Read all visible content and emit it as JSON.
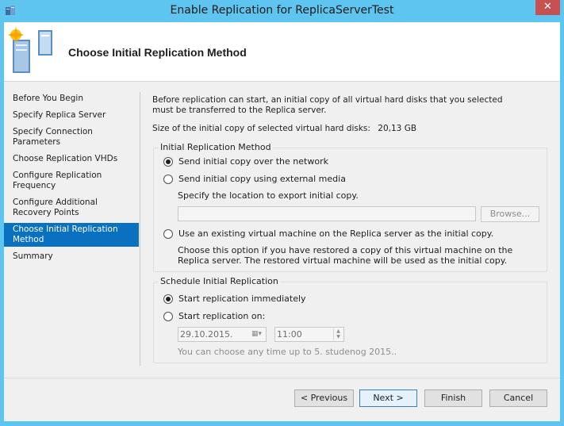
{
  "window": {
    "title": "Enable Replication for ReplicaServerTest",
    "close_glyph": "✕"
  },
  "header": {
    "title": "Choose Initial Replication Method",
    "icon": "server-wizard-icon"
  },
  "nav": {
    "items": [
      {
        "label": "Before You Begin",
        "active": false
      },
      {
        "label": "Specify Replica Server",
        "active": false
      },
      {
        "label": "Specify Connection Parameters",
        "active": false
      },
      {
        "label": "Choose Replication VHDs",
        "active": false
      },
      {
        "label": "Configure Replication Frequency",
        "active": false
      },
      {
        "label": "Configure Additional Recovery Points",
        "active": false
      },
      {
        "label": "Choose Initial Replication Method",
        "active": true
      },
      {
        "label": "Summary",
        "active": false
      }
    ]
  },
  "content": {
    "intro": "Before replication can start, an initial copy of all virtual hard disks that you selected must be transferred to the Replica server.",
    "size_label": "Size of the initial copy of selected virtual hard disks:",
    "size_value": "20,13 GB",
    "method_group": {
      "title": "Initial Replication Method",
      "opt_network": "Send initial copy over the network",
      "opt_network_checked": true,
      "opt_media": "Send initial copy using external media",
      "opt_media_checked": false,
      "export_label": "Specify the location to export initial copy.",
      "export_value": "",
      "browse_label": "Browse...",
      "opt_existing": "Use an existing virtual machine on the Replica server as the initial copy.",
      "opt_existing_checked": false,
      "existing_desc": "Choose this option if you have restored a copy of this virtual machine on the Replica server. The restored virtual machine will be used as the initial copy."
    },
    "schedule_group": {
      "title": "Schedule Initial Replication",
      "opt_immediately": "Start replication immediately",
      "opt_immediately_checked": true,
      "opt_on": "Start replication on:",
      "opt_on_checked": false,
      "date_value": "29.10.2015.",
      "time_value": "11:00",
      "hint": "You can choose any time up to 5. studenog 2015.."
    }
  },
  "buttons": {
    "previous": "< Previous",
    "next": "Next >",
    "finish": "Finish",
    "cancel": "Cancel"
  },
  "colors": {
    "titlebar": "#5ec4f0",
    "close": "#c75050",
    "nav_active": "#0a70c0"
  }
}
